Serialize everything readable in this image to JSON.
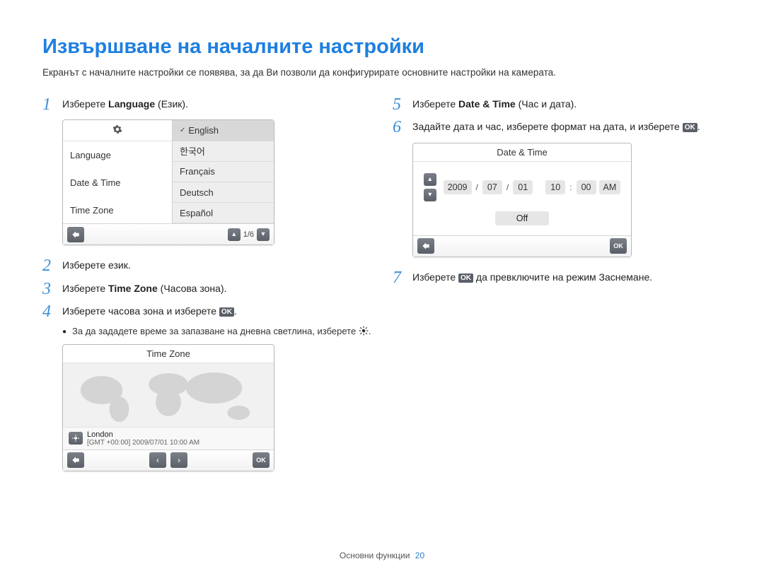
{
  "title": "Извършване на началните настройки",
  "intro": "Екранът с началните настройки се появява, за да Ви позволи да конфигурирате основните настройки на камерата.",
  "steps": {
    "1": {
      "prefix": "Изберете ",
      "bold": "Language",
      "suffix": " (Език)."
    },
    "2": {
      "text": "Изберете език."
    },
    "3": {
      "prefix": "Изберете ",
      "bold": "Time Zone",
      "suffix": " (Часова зона)."
    },
    "4": {
      "prefix": "Изберете часова зона и изберете ",
      "ok": true,
      "suffix2": "."
    },
    "4b": {
      "text": "За да зададете време за запазване на дневна светлина, изберете "
    },
    "5": {
      "prefix": "Изберете ",
      "bold": "Date & Time",
      "suffix": " (Час и дата)."
    },
    "6": {
      "text_a": "Задайте дата и час, изберете формат на дата, и изберете ",
      "ok": true,
      "text_b": "."
    },
    "7": {
      "text_a": "Изберете ",
      "ok": true,
      "text_b": " да превключите на режим Заснемане."
    }
  },
  "lang_screen": {
    "left": [
      "Language",
      "Date & Time",
      "Time Zone"
    ],
    "right": [
      "English",
      "한국어",
      "Français",
      "Deutsch",
      "Español"
    ],
    "pager": "1/6"
  },
  "tz_screen": {
    "title": "Time Zone",
    "city": "London",
    "info": "[GMT +00:00] 2009/07/01 10:00 AM",
    "ok": "OK"
  },
  "dt_screen": {
    "title": "Date & Time",
    "year": "2009",
    "month": "07",
    "day": "01",
    "hour": "10",
    "min": "00",
    "ampm": "AM",
    "off": "Off",
    "ok": "OK"
  },
  "footer": {
    "label": "Основни функции",
    "page": "20"
  }
}
